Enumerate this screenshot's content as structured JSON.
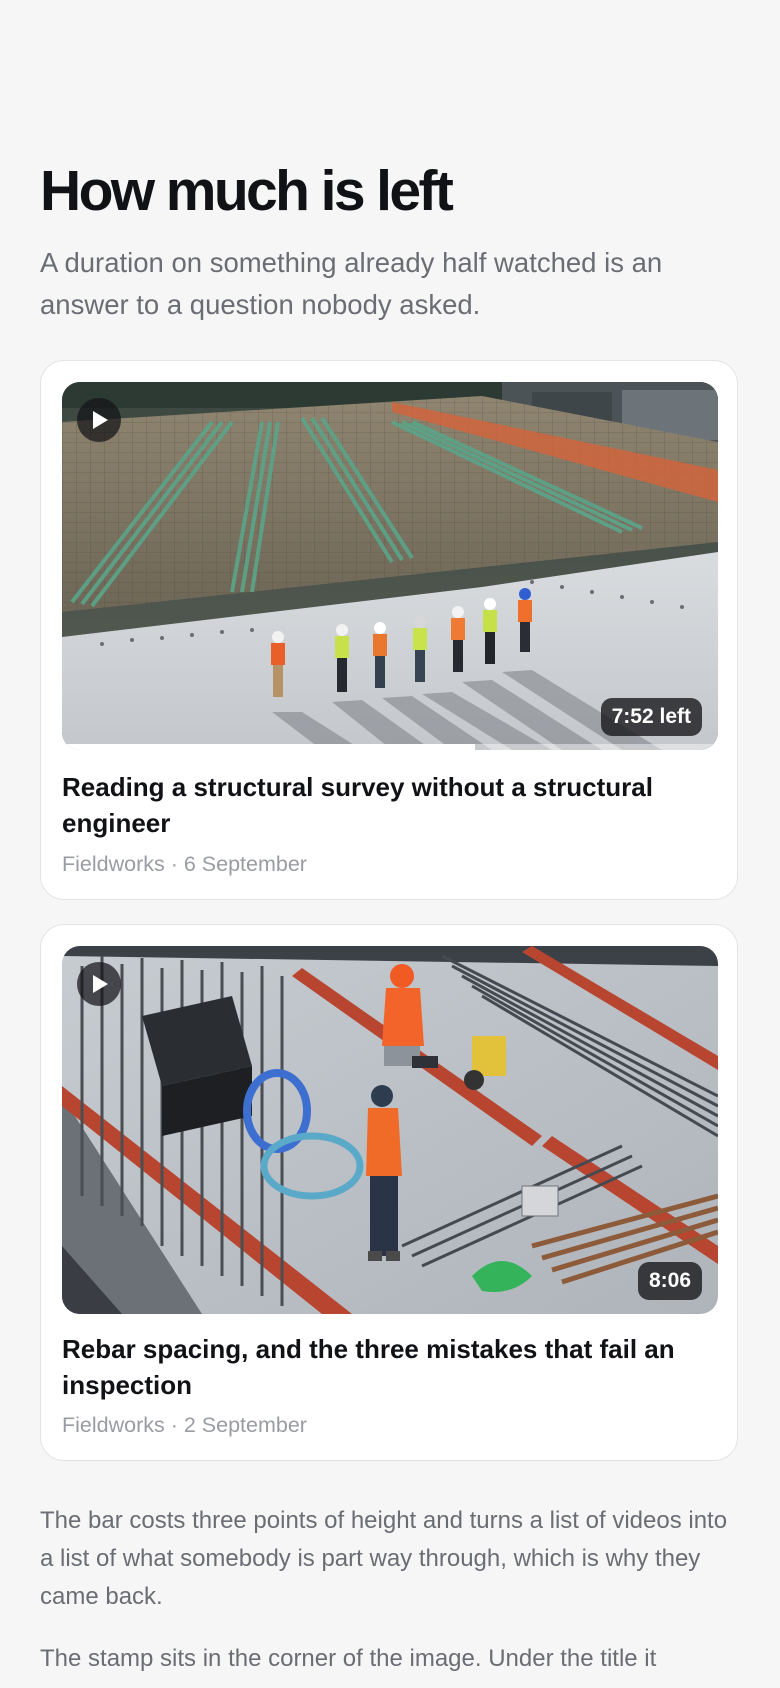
{
  "page": {
    "heading": "How much is left",
    "intro": "A duration on something already half watched is an answer to a question nobody asked.",
    "paragraphs": [
      "The bar costs three points of height and turns a list of videos into a list of what somebody is part way through, which is why they came back.",
      "The stamp sits in the corner of the image. Under the title it"
    ]
  },
  "videos": [
    {
      "title": "Reading a structural survey without a structural engineer",
      "source": "Fieldworks",
      "date": "6 September",
      "meta": "Fieldworks · 6 September",
      "stamp": "7:52 left",
      "progress": 0.63,
      "icon": "play-icon"
    },
    {
      "title": "Rebar spacing, and the three mistakes that fail an inspection",
      "source": "Fieldworks",
      "date": "2 September",
      "meta": "Fieldworks · 2 September",
      "stamp": "8:06",
      "icon": "play-icon"
    }
  ],
  "colors": {
    "background": "#f6f6f6",
    "card": "#ffffff",
    "heading": "#111216",
    "muted": "#6b6d74",
    "meta": "#9a9ca3",
    "stamp_bg": "#141418"
  }
}
